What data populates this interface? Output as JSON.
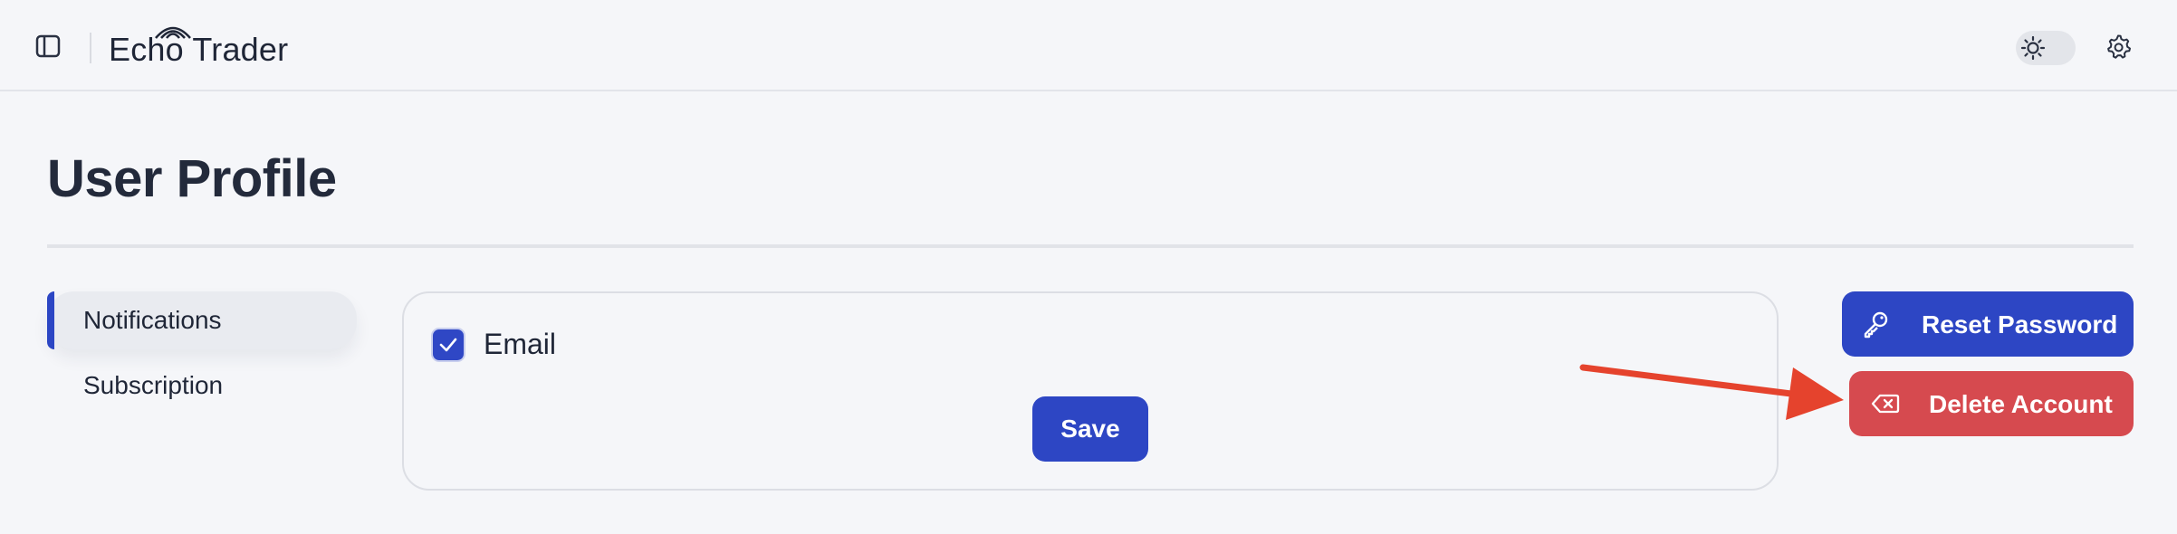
{
  "header": {
    "app_name": "Echo Trader",
    "icons": {
      "sidebar_toggle": "sidebar-panel-icon",
      "theme": "sun-icon",
      "settings": "gear-icon"
    }
  },
  "page": {
    "title": "User Profile"
  },
  "nav": {
    "items": [
      {
        "label": "Notifications",
        "active": true
      },
      {
        "label": "Subscription",
        "active": false
      }
    ]
  },
  "notifications": {
    "email_label": "Email",
    "email_checked": true,
    "save_label": "Save"
  },
  "actions": {
    "reset_label": "Reset Password",
    "reset_icon": "key-icon",
    "delete_label": "Delete Account",
    "delete_icon": "backspace-x-icon"
  },
  "annotation": {
    "arrow_color": "#e5432d"
  },
  "colors": {
    "primary": "#2d46c4",
    "danger": "#d64a4f",
    "background": "#f5f6f9"
  }
}
